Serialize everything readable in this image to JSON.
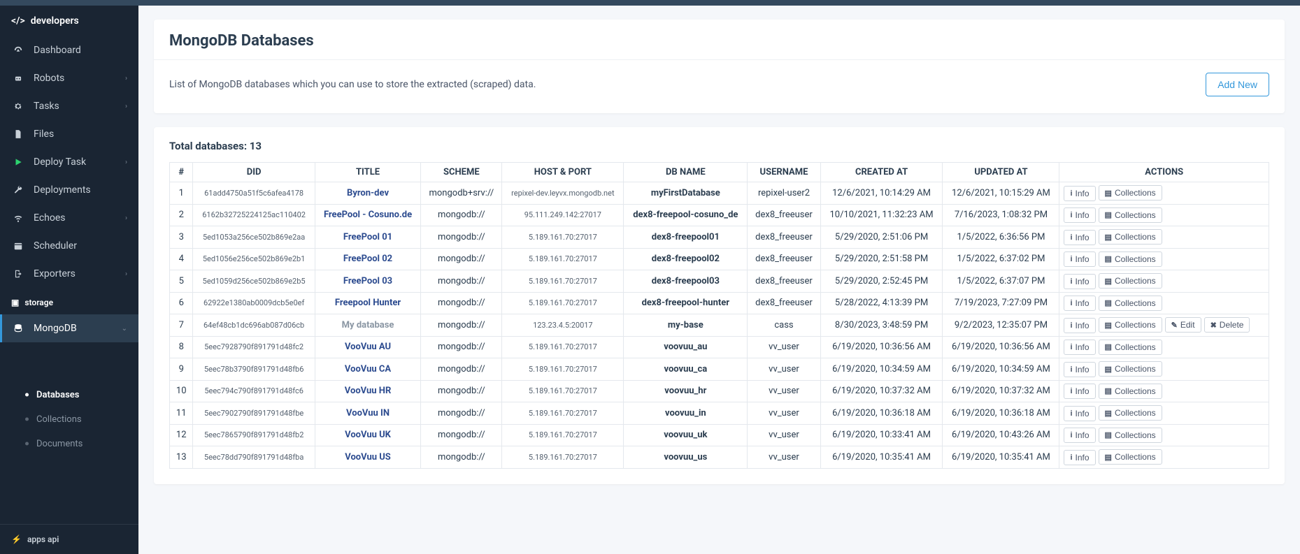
{
  "brand": "developers",
  "sidebar": {
    "items": [
      {
        "label": "Dashboard",
        "icon": "gauge",
        "expandable": false
      },
      {
        "label": "Robots",
        "icon": "robot",
        "expandable": true
      },
      {
        "label": "Tasks",
        "icon": "gear",
        "expandable": true
      },
      {
        "label": "Files",
        "icon": "file",
        "expandable": false
      },
      {
        "label": "Deploy Task",
        "icon": "play",
        "expandable": true,
        "accent": "deploy"
      },
      {
        "label": "Deployments",
        "icon": "wrench",
        "expandable": false
      },
      {
        "label": "Echoes",
        "icon": "wifi",
        "expandable": true
      },
      {
        "label": "Scheduler",
        "icon": "calendar",
        "expandable": false
      },
      {
        "label": "Exporters",
        "icon": "export",
        "expandable": true
      }
    ],
    "storage_header": "storage",
    "mongodb_label": "MongoDB",
    "sub_items": [
      {
        "label": "Databases",
        "selected": true
      },
      {
        "label": "Collections",
        "selected": false
      },
      {
        "label": "Documents",
        "selected": false
      }
    ],
    "apps_api": "apps api"
  },
  "page": {
    "title": "MongoDB Databases",
    "description": "List of MongoDB databases which you can use to store the extracted (scraped) data.",
    "add_new": "Add New",
    "total_label": "Total databases: 13"
  },
  "table": {
    "headers": [
      "#",
      "DID",
      "TITLE",
      "SCHEME",
      "HOST & PORT",
      "DB NAME",
      "USERNAME",
      "CREATED AT",
      "UPDATED AT",
      "ACTIONS"
    ],
    "action_labels": {
      "info": "Info",
      "collections": "Collections",
      "edit": "Edit",
      "delete": "Delete"
    },
    "rows": [
      {
        "n": "1",
        "did": "61add4750a51f5c6afea4178",
        "title": "Byron-dev",
        "scheme": "mongodb+srv://",
        "host": "repixel-dev.leyvx.mongodb.net",
        "db": "myFirstDatabase",
        "user": "repixel-user2",
        "created": "12/6/2021, 10:14:29 AM",
        "updated": "12/6/2021, 10:15:29 AM",
        "own": false
      },
      {
        "n": "2",
        "did": "6162b32725224125ac110402",
        "title": "FreePool - Cosuno.de",
        "scheme": "mongodb://",
        "host": "95.111.249.142:27017",
        "db": "dex8-freepool-cosuno_de",
        "user": "dex8_freeuser",
        "created": "10/10/2021, 11:32:23 AM",
        "updated": "7/16/2023, 1:08:32 PM",
        "own": false
      },
      {
        "n": "3",
        "did": "5ed1053a256ce502b869e2aa",
        "title": "FreePool 01",
        "scheme": "mongodb://",
        "host": "5.189.161.70:27017",
        "db": "dex8-freepool01",
        "user": "dex8_freeuser",
        "created": "5/29/2020, 2:51:06 PM",
        "updated": "1/5/2022, 6:36:56 PM",
        "own": false
      },
      {
        "n": "4",
        "did": "5ed1056e256ce502b869e2b1",
        "title": "FreePool 02",
        "scheme": "mongodb://",
        "host": "5.189.161.70:27017",
        "db": "dex8-freepool02",
        "user": "dex8_freeuser",
        "created": "5/29/2020, 2:51:58 PM",
        "updated": "1/5/2022, 6:37:02 PM",
        "own": false
      },
      {
        "n": "5",
        "did": "5ed1059d256ce502b869e2b5",
        "title": "FreePool 03",
        "scheme": "mongodb://",
        "host": "5.189.161.70:27017",
        "db": "dex8-freepool03",
        "user": "dex8_freeuser",
        "created": "5/29/2020, 2:52:45 PM",
        "updated": "1/5/2022, 6:37:07 PM",
        "own": false
      },
      {
        "n": "6",
        "did": "62922e1380ab0009dcb5e0ef",
        "title": "Freepool Hunter",
        "scheme": "mongodb://",
        "host": "5.189.161.70:27017",
        "db": "dex8-freepool-hunter",
        "user": "dex8_freeuser",
        "created": "5/28/2022, 4:13:39 PM",
        "updated": "7/19/2023, 7:27:09 PM",
        "own": false
      },
      {
        "n": "7",
        "did": "64ef48cb1dc696ab087d06cb",
        "title": "My database",
        "scheme": "mongodb://",
        "host": "123.23.4.5:20017",
        "db": "my-base",
        "user": "cass",
        "created": "8/30/2023, 3:48:59 PM",
        "updated": "9/2/2023, 12:35:07 PM",
        "own": true
      },
      {
        "n": "8",
        "did": "5eec7928790f891791d48fc2",
        "title": "VooVuu AU",
        "scheme": "mongodb://",
        "host": "5.189.161.70:27017",
        "db": "voovuu_au",
        "user": "vv_user",
        "created": "6/19/2020, 10:36:56 AM",
        "updated": "6/19/2020, 10:36:56 AM",
        "own": false
      },
      {
        "n": "9",
        "did": "5eec78b3790f891791d48fb6",
        "title": "VooVuu CA",
        "scheme": "mongodb://",
        "host": "5.189.161.70:27017",
        "db": "voovuu_ca",
        "user": "vv_user",
        "created": "6/19/2020, 10:34:59 AM",
        "updated": "6/19/2020, 10:34:59 AM",
        "own": false
      },
      {
        "n": "10",
        "did": "5eec794c790f891791d48fc6",
        "title": "VooVuu HR",
        "scheme": "mongodb://",
        "host": "5.189.161.70:27017",
        "db": "voovuu_hr",
        "user": "vv_user",
        "created": "6/19/2020, 10:37:32 AM",
        "updated": "6/19/2020, 10:37:32 AM",
        "own": false
      },
      {
        "n": "11",
        "did": "5eec7902790f891791d48fbe",
        "title": "VooVuu IN",
        "scheme": "mongodb://",
        "host": "5.189.161.70:27017",
        "db": "voovuu_in",
        "user": "vv_user",
        "created": "6/19/2020, 10:36:18 AM",
        "updated": "6/19/2020, 10:36:18 AM",
        "own": false
      },
      {
        "n": "12",
        "did": "5eec7865790f891791d48fb2",
        "title": "VooVuu UK",
        "scheme": "mongodb://",
        "host": "5.189.161.70:27017",
        "db": "voovuu_uk",
        "user": "vv_user",
        "created": "6/19/2020, 10:33:41 AM",
        "updated": "6/19/2020, 10:43:26 AM",
        "own": false
      },
      {
        "n": "13",
        "did": "5eec78dd790f891791d48fba",
        "title": "VooVuu US",
        "scheme": "mongodb://",
        "host": "5.189.161.70:27017",
        "db": "voovuu_us",
        "user": "vv_user",
        "created": "6/19/2020, 10:35:41 AM",
        "updated": "6/19/2020, 10:35:41 AM",
        "own": false
      }
    ]
  }
}
